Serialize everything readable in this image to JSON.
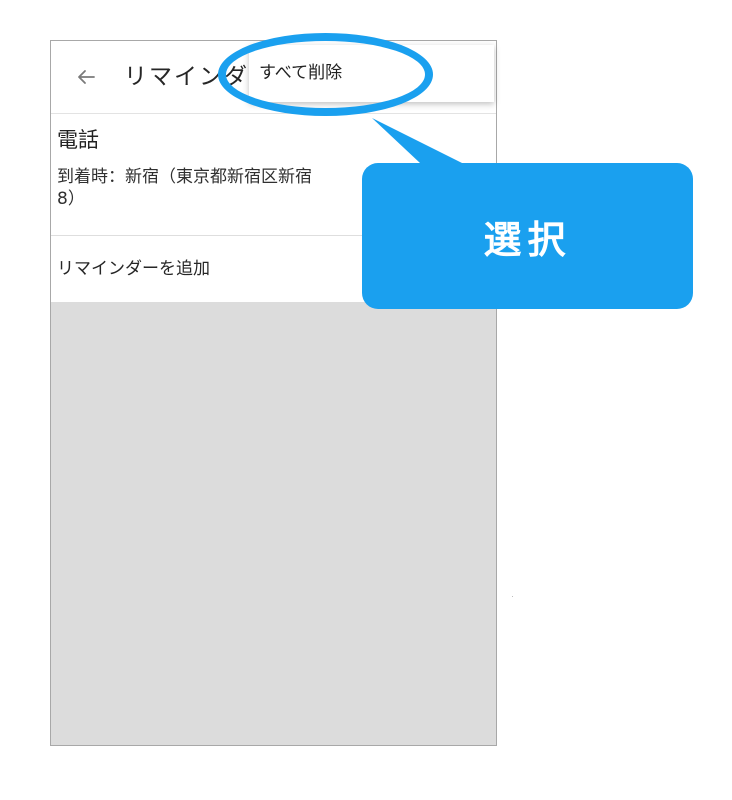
{
  "appbar": {
    "title": "リマインダー"
  },
  "reminder": {
    "title": "電話",
    "detail": "到着時：新宿（東京都新宿区新宿\n8）"
  },
  "add_reminder": {
    "label": "リマインダーを追加"
  },
  "popup_menu": {
    "items": [
      {
        "label": "すべて削除"
      }
    ]
  },
  "annotation": {
    "label": "選択",
    "color": "#1aa0ef"
  },
  "icons": {
    "back": "back-arrow-icon"
  }
}
